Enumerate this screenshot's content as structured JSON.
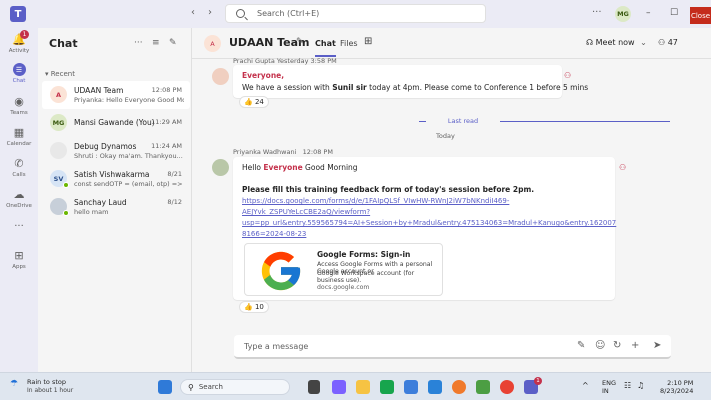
{
  "titlebar": {
    "search_placeholder": "Search (Ctrl+E)",
    "back": "‹",
    "forward": "›",
    "more": "···",
    "user_initials": "MG",
    "minimize": "–",
    "maximize": "☐",
    "close_label": "Close"
  },
  "rail": {
    "items": [
      {
        "label": "Activity",
        "badge": "1"
      },
      {
        "label": "Chat"
      },
      {
        "label": "Teams"
      },
      {
        "label": "Calendar"
      },
      {
        "label": "Calls"
      },
      {
        "label": "OneDrive"
      },
      {
        "label": "···"
      },
      {
        "label": "Apps"
      }
    ]
  },
  "chatlist": {
    "title": "Chat",
    "section": "Recent",
    "items": [
      {
        "initials": "A",
        "name": "UDAAN Team",
        "time": "12:08 PM",
        "preview": "Priyanka: Hello Everyone Good Mo..."
      },
      {
        "initials": "MG",
        "name": "Mansi Gawande (You)",
        "time": "11:29 AM",
        "preview": ""
      },
      {
        "initials": "",
        "name": "Debug Dynamos",
        "time": "11:24 AM",
        "preview": "Shruti : Okay ma'am. Thankyou..."
      },
      {
        "initials": "SV",
        "name": "Satish Vishwakarma",
        "time": "8/21",
        "preview": "const sendOTP = (email, otp) => { ..."
      },
      {
        "initials": "",
        "name": "Sanchay Laud",
        "time": "8/12",
        "preview": "hello mam"
      }
    ]
  },
  "header": {
    "group_initials": "A",
    "title": "UDAAN Team",
    "tabs": [
      "Chat",
      "Files"
    ],
    "meet_label": "Meet now",
    "people_count": "47"
  },
  "messages": {
    "first": {
      "author_time": "Prachi Gupta   Yesterday 3:58 PM",
      "mention": "Everyone,",
      "text_before": "We have a session with ",
      "bold_name": "Sunil sir",
      "text_after": " today at 4pm. Please come to Conference 1 before 5 mins",
      "reaction_count": "24"
    },
    "last_read": "Last read",
    "today": "Today",
    "second": {
      "author": "Priyanka Wadhwani",
      "time": "12:08 PM",
      "hello": "Hello ",
      "mention": "Everyone",
      "rest": " Good Morning",
      "bold_line": "Please fill this training feedback form of today's session before 2pm.",
      "link_lines": [
        "https://docs.google.com/forms/d/e/1FAIpQLSf_VIwHW-RWnJ2iW7bNKndiI469-",
        "AEJYvk_ZSPUYeLcCBE2aQ/viewform?",
        "usp=pp_url&entry.559565794=AI+Session+by+Mradul&entry.475134063=Mradul+Kanugo&entry.162007",
        "8166=2024-08-23"
      ],
      "card_title": "Google Forms: Sign-in",
      "card_desc_1": "Access Google Forms with a personal Google account or",
      "card_desc_2": "Google Workspace account (for business use).",
      "card_domain": "docs.google.com",
      "reaction_count": "10"
    }
  },
  "compose": {
    "placeholder": "Type a message"
  },
  "taskbar": {
    "weather_title": "Rain to stop",
    "weather_sub": "In about 1 hour",
    "search": "Search",
    "teams_badge": "1",
    "lang_1": "ENG",
    "lang_2": "IN",
    "time": "2:10 PM",
    "date": "8/23/2024"
  },
  "colors": {
    "accent": "#5b5fc7",
    "mention": "#c4314b",
    "close": "#c42b1c"
  }
}
